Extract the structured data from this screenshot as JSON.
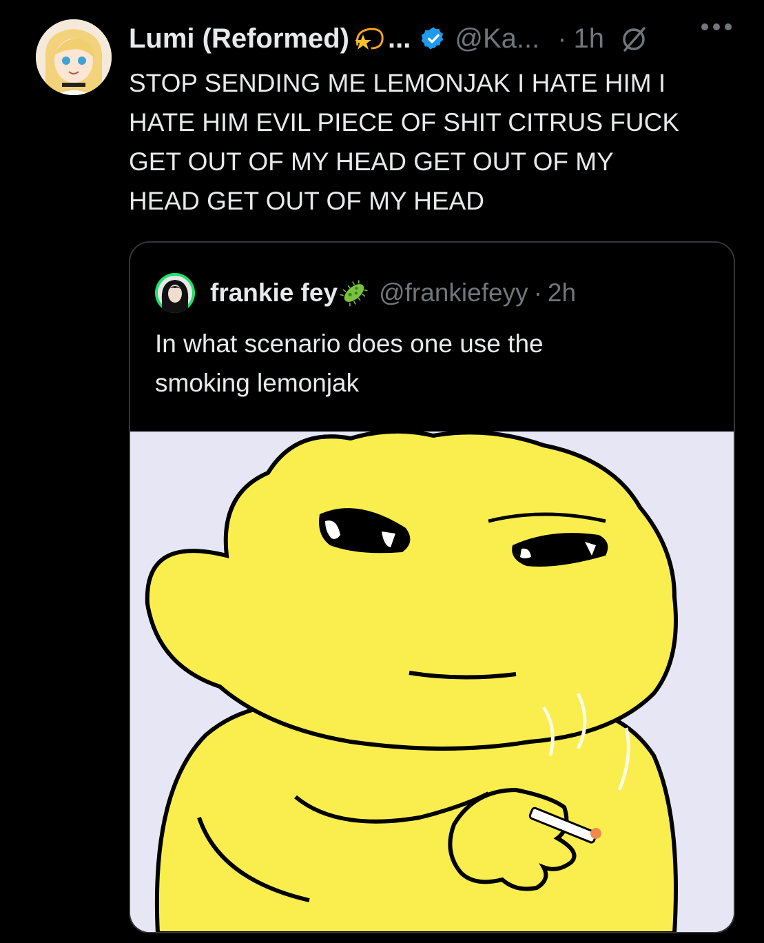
{
  "post": {
    "author_name": "Lumi (Reformed)",
    "name_ellipsis": "...",
    "handle": "@Ka...",
    "separator": "·",
    "time": "1h",
    "text": "STOP SENDING ME LEMONJAK I HATE HIM I\nHATE HIM EVIL PIECE OF SHIT CITRUS FUCK\nGET OUT OF MY HEAD GET OUT OF MY\nHEAD GET OUT OF MY HEAD",
    "icons": [
      "dizzy-star-emoji-icon",
      "verified-badge-icon",
      "grok-icon",
      "more-options-icon"
    ]
  },
  "quoted_post": {
    "author_name": "frankie fey",
    "handle": "@frankiefeyy",
    "separator": "·",
    "time": "2h",
    "text": "In what scenario does one use the\nsmoking lemonjak",
    "icons": [
      "microbe-emoji-icon"
    ]
  },
  "colors": {
    "background": "#000000",
    "text": "#e7e9ea",
    "muted": "#71767b",
    "verified": "#1d9bf0",
    "border": "#333639",
    "lemon": "#f9ee4d",
    "image_bg": "#e6e6f4"
  }
}
